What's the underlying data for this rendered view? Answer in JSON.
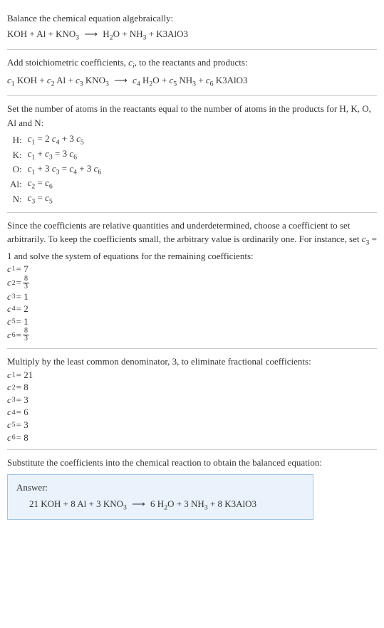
{
  "s1": {
    "line1": "Balance the chemical equation algebraically:",
    "eq_lhs1": "KOH + Al + KNO",
    "eq_s1": "3",
    "eq_arrow": "⟶",
    "eq_rhs1a": "H",
    "eq_rhs1as": "2",
    "eq_rhs1b": "O + NH",
    "eq_rhs1bs": "3",
    "eq_rhs1c": " + K3AlO3"
  },
  "s2": {
    "line1a": "Add stoichiometric coefficients, ",
    "ci": "c",
    "cisub": "i",
    "line1b": ", to the reactants and products:",
    "c1": "c",
    "c1s": "1",
    "t1": " KOH + ",
    "c2": "c",
    "c2s": "2",
    "t2": " Al + ",
    "c3": "c",
    "c3s": "3",
    "t3": " KNO",
    "t3s": "3",
    "arrow": "⟶",
    "c4": "c",
    "c4s": "4",
    "t4a": " H",
    "t4as": "2",
    "t4b": "O + ",
    "c5": "c",
    "c5s": "5",
    "t5": " NH",
    "t5s": "3",
    "t5b": " + ",
    "c6": "c",
    "c6s": "6",
    "t6": " K3AlO3"
  },
  "s3": {
    "intro": "Set the number of atoms in the reactants equal to the number of atoms in the products for H, K, O, Al and N:",
    "rows": [
      {
        "label": "H:",
        "eq_a": "c",
        "eq_as": "1",
        "eq_mid": " = 2 ",
        "eq_b": "c",
        "eq_bs": "4",
        "eq_c": " + 3 ",
        "eq_d": "c",
        "eq_ds": "5"
      },
      {
        "label": "K:",
        "eq_a": "c",
        "eq_as": "1",
        "eq_mid": " + ",
        "eq_b": "c",
        "eq_bs": "3",
        "eq_c": " = 3 ",
        "eq_d": "c",
        "eq_ds": "6"
      },
      {
        "label": "O:",
        "eq_a": "c",
        "eq_as": "1",
        "eq_mid": " + 3 ",
        "eq_b": "c",
        "eq_bs": "3",
        "eq_c": " = ",
        "eq_d": "c",
        "eq_ds": "4",
        "eq_e": " + 3 ",
        "eq_f": "c",
        "eq_fs": "6"
      },
      {
        "label": "Al:",
        "eq_a": "c",
        "eq_as": "2",
        "eq_mid": " = ",
        "eq_b": "c",
        "eq_bs": "6"
      },
      {
        "label": "N:",
        "eq_a": "c",
        "eq_as": "3",
        "eq_mid": " = ",
        "eq_b": "c",
        "eq_bs": "5"
      }
    ]
  },
  "s4": {
    "intro_a": "Since the coefficients are relative quantities and underdetermined, choose a coefficient to set arbitrarily. To keep the coefficients small, the arbitrary value is ordinarily one. For instance, set ",
    "c3": "c",
    "c3s": "3",
    "eq1": " = 1",
    "intro_b": " and solve the system of equations for the remaining coefficients:",
    "coeffs": [
      {
        "c": "c",
        "cs": "1",
        "val": " = 7"
      },
      {
        "c": "c",
        "cs": "2",
        "val": " = ",
        "frac_n": "8",
        "frac_d": "3"
      },
      {
        "c": "c",
        "cs": "3",
        "val": " = 1"
      },
      {
        "c": "c",
        "cs": "4",
        "val": " = 2"
      },
      {
        "c": "c",
        "cs": "5",
        "val": " = 1"
      },
      {
        "c": "c",
        "cs": "6",
        "val": " = ",
        "frac_n": "8",
        "frac_d": "3"
      }
    ]
  },
  "s5": {
    "intro": "Multiply by the least common denominator, 3, to eliminate fractional coefficients:",
    "coeffs": [
      {
        "c": "c",
        "cs": "1",
        "val": " = 21"
      },
      {
        "c": "c",
        "cs": "2",
        "val": " = 8"
      },
      {
        "c": "c",
        "cs": "3",
        "val": " = 3"
      },
      {
        "c": "c",
        "cs": "4",
        "val": " = 6"
      },
      {
        "c": "c",
        "cs": "5",
        "val": " = 3"
      },
      {
        "c": "c",
        "cs": "6",
        "val": " = 8"
      }
    ]
  },
  "s6": {
    "intro": "Substitute the coefficients into the chemical reaction to obtain the balanced equation:",
    "answer_label": "Answer:",
    "eq_l1": "21 KOH + 8 Al + 3 KNO",
    "eq_l1s": "3",
    "arrow": "⟶",
    "eq_r1a": "6 H",
    "eq_r1as": "2",
    "eq_r1b": "O + 3 NH",
    "eq_r1bs": "3",
    "eq_r1c": " + 8 K3AlO3"
  }
}
